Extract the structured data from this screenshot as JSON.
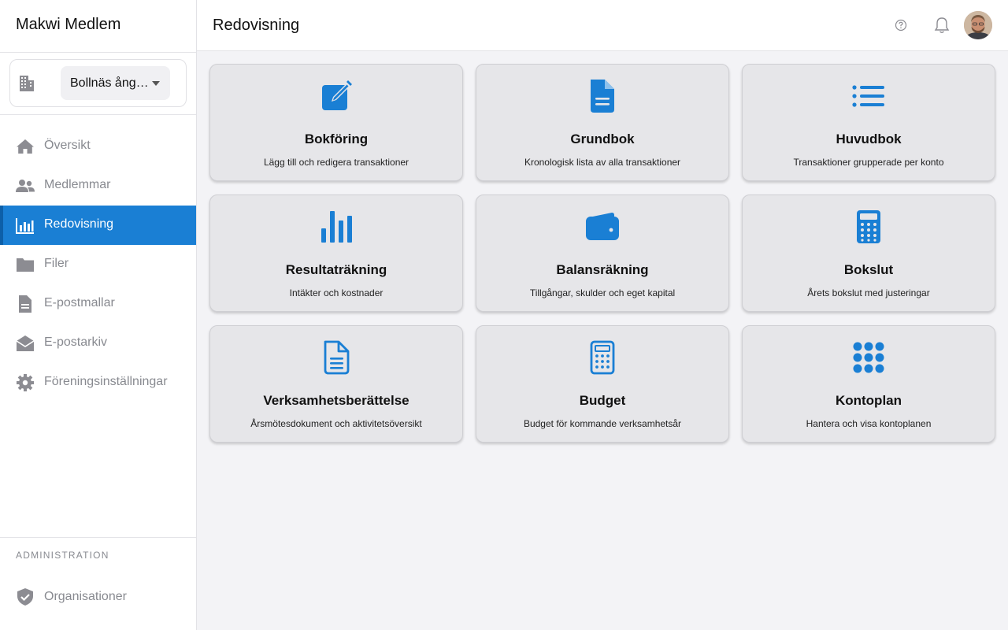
{
  "app": {
    "title": "Makwi Medlem"
  },
  "org_selector": {
    "value": "Bollnäs ång…"
  },
  "nav": {
    "items": [
      {
        "label": "Översikt"
      },
      {
        "label": "Medlemmar"
      },
      {
        "label": "Redovisning"
      },
      {
        "label": "Filer"
      },
      {
        "label": "E-postmallar"
      },
      {
        "label": "E-postarkiv"
      },
      {
        "label": "Föreningsinställningar"
      }
    ],
    "active_index": 2
  },
  "admin": {
    "section_label": "ADMINISTRATION",
    "item_label": "Organisationer"
  },
  "header": {
    "title": "Redovisning"
  },
  "colors": {
    "accent": "#1a7fd4",
    "icon_blue": "#1a7fd4",
    "muted_text": "#888a90",
    "card_bg": "#e6e6e9"
  },
  "cards": [
    {
      "icon": "edit-icon",
      "title": "Bokföring",
      "description": "Lägg till och redigera transaktioner"
    },
    {
      "icon": "document-icon",
      "title": "Grundbok",
      "description": "Kronologisk lista av alla transaktioner"
    },
    {
      "icon": "list-icon",
      "title": "Huvudbok",
      "description": "Transaktioner grupperade per konto"
    },
    {
      "icon": "bar-chart-icon",
      "title": "Resultaträkning",
      "description": "Intäkter och kostnader"
    },
    {
      "icon": "wallet-icon",
      "title": "Balansräkning",
      "description": "Tillgångar, skulder och eget kapital"
    },
    {
      "icon": "calculator-icon",
      "title": "Bokslut",
      "description": "Årets bokslut med justeringar"
    },
    {
      "icon": "document-outline-icon",
      "title": "Verksamhetsberättelse",
      "description": "Årsmötesdokument och aktivitetsöversikt"
    },
    {
      "icon": "calculator-outline-icon",
      "title": "Budget",
      "description": "Budget för kommande verksamhetsår"
    },
    {
      "icon": "grid-dots-icon",
      "title": "Kontoplan",
      "description": "Hantera och visa kontoplanen"
    }
  ]
}
